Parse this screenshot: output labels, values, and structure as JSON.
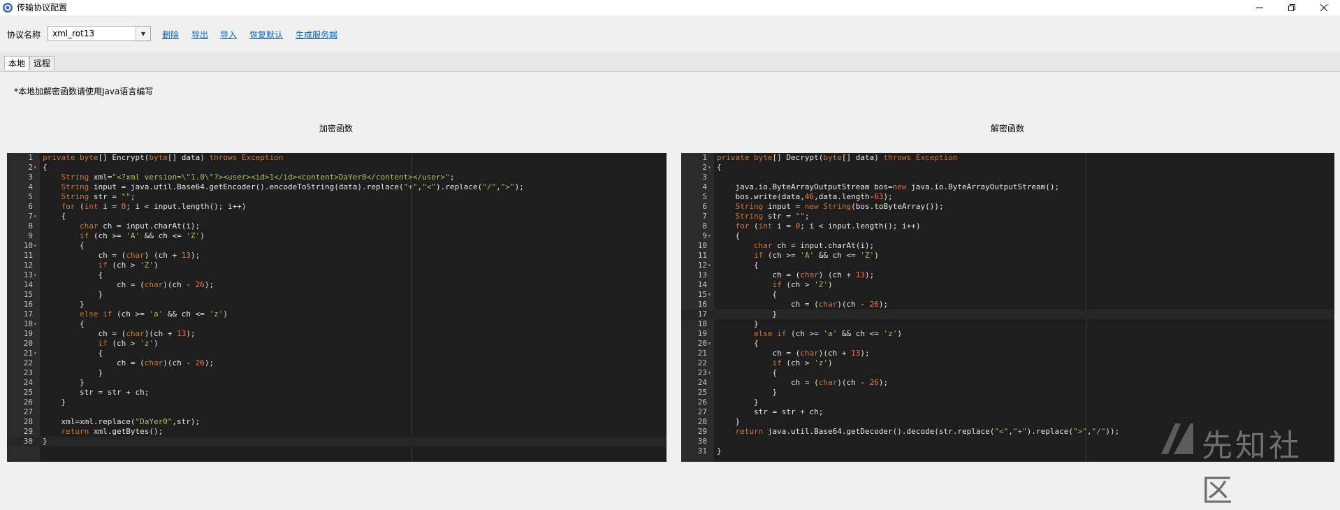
{
  "window": {
    "title": "传输协议配置"
  },
  "toolbar": {
    "protocol_label": "协议名称",
    "protocol_value": "xml_rot13",
    "links": [
      "删除",
      "导出",
      "导入",
      "恢复默认",
      "生成服务端"
    ]
  },
  "tabs": [
    {
      "label": "本地",
      "active": true
    },
    {
      "label": "远程",
      "active": false
    }
  ],
  "note": "*本地加解密函数请使用Java语言编写",
  "encrypt": {
    "heading": "加密函数",
    "cursor_line": 30,
    "lines": [
      "private byte[] Encrypt(byte[] data) throws Exception",
      "{",
      "    String xml=\"<?xml version=\\\"1.0\\\"?><user><id>1</id><content>DaYer0</content></user>\";",
      "    String input = java.util.Base64.getEncoder().encodeToString(data).replace(\"+\",\"<\").replace(\"/\",\">\");",
      "    String str = \"\";",
      "    for (int i = 0; i < input.length(); i++)",
      "    {",
      "        char ch = input.charAt(i);",
      "        if (ch >= 'A' && ch <= 'Z')",
      "        {",
      "            ch = (char) (ch + 13);",
      "            if (ch > 'Z')",
      "            {",
      "                ch = (char)(ch - 26);",
      "            }",
      "        }",
      "        else if (ch >= 'a' && ch <= 'z')",
      "        {",
      "            ch = (char)(ch + 13);",
      "            if (ch > 'z')",
      "            {",
      "                ch = (char)(ch - 26);",
      "            }",
      "        }",
      "        str = str + ch;",
      "    }",
      "",
      "    xml=xml.replace(\"DaYer0\",str);",
      "    return xml.getBytes();",
      "}"
    ]
  },
  "decrypt": {
    "heading": "解密函数",
    "cursor_line": 17,
    "lines": [
      "private byte[] Decrypt(byte[] data) throws Exception",
      "{",
      "",
      "    java.io.ByteArrayOutputStream bos=new java.io.ByteArrayOutputStream();",
      "    bos.write(data,46,data.length-63);",
      "    String input = new String(bos.toByteArray());",
      "    String str = \"\";",
      "    for (int i = 0; i < input.length(); i++)",
      "    {",
      "        char ch = input.charAt(i);",
      "        if (ch >= 'A' && ch <= 'Z')",
      "        {",
      "            ch = (char) (ch + 13);",
      "            if (ch > 'Z')",
      "            {",
      "                ch = (char)(ch - 26);",
      "            }",
      "        }",
      "        else if (ch >= 'a' && ch <= 'z')",
      "        {",
      "            ch = (char)(ch + 13);",
      "            if (ch > 'z')",
      "            {",
      "                ch = (char)(ch - 26);",
      "            }",
      "        }",
      "        str = str + ch;",
      "    }",
      "    return java.util.Base64.getDecoder().decode(str.replace(\"<\",\"+\").replace(\">\",\"/\"));",
      "",
      "}"
    ]
  },
  "watermark": "先知社区",
  "colors": {
    "keyword": "#cc7832",
    "string": "#a5c25c",
    "number": "#ee7744",
    "link": "#0a66c2",
    "editor_bg": "#1e1e1e"
  }
}
